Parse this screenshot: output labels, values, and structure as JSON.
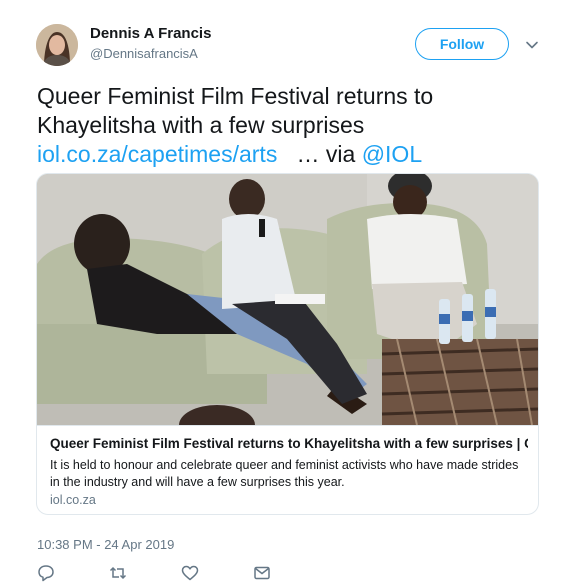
{
  "author": {
    "name": "Dennis A Francis",
    "handle": "@DennisafrancisA"
  },
  "follow_label": "Follow",
  "tweet": {
    "line1": "Queer Feminist Film Festival returns to",
    "line2": "Khayelitsha with a few surprises",
    "link_text": "iol.co.za/capetimes/arts",
    "ellipsis_via": "… via",
    "mention": "@IOL"
  },
  "card": {
    "title": "Queer Feminist Film Festival returns to Khayelitsha with a few surprises | Ca...",
    "description": "It is held to honour and celebrate queer and feminist activists who have made strides in the industry and will have a few surprises this year.",
    "domain": "iol.co.za"
  },
  "timestamp": "10:38 PM - 24 Apr 2019",
  "actions": [
    "reply-icon",
    "retweet-icon",
    "like-icon",
    "message-icon"
  ],
  "colors": {
    "accent": "#1da1f2",
    "secondary_text": "#657786",
    "border": "#e1e8ed"
  }
}
